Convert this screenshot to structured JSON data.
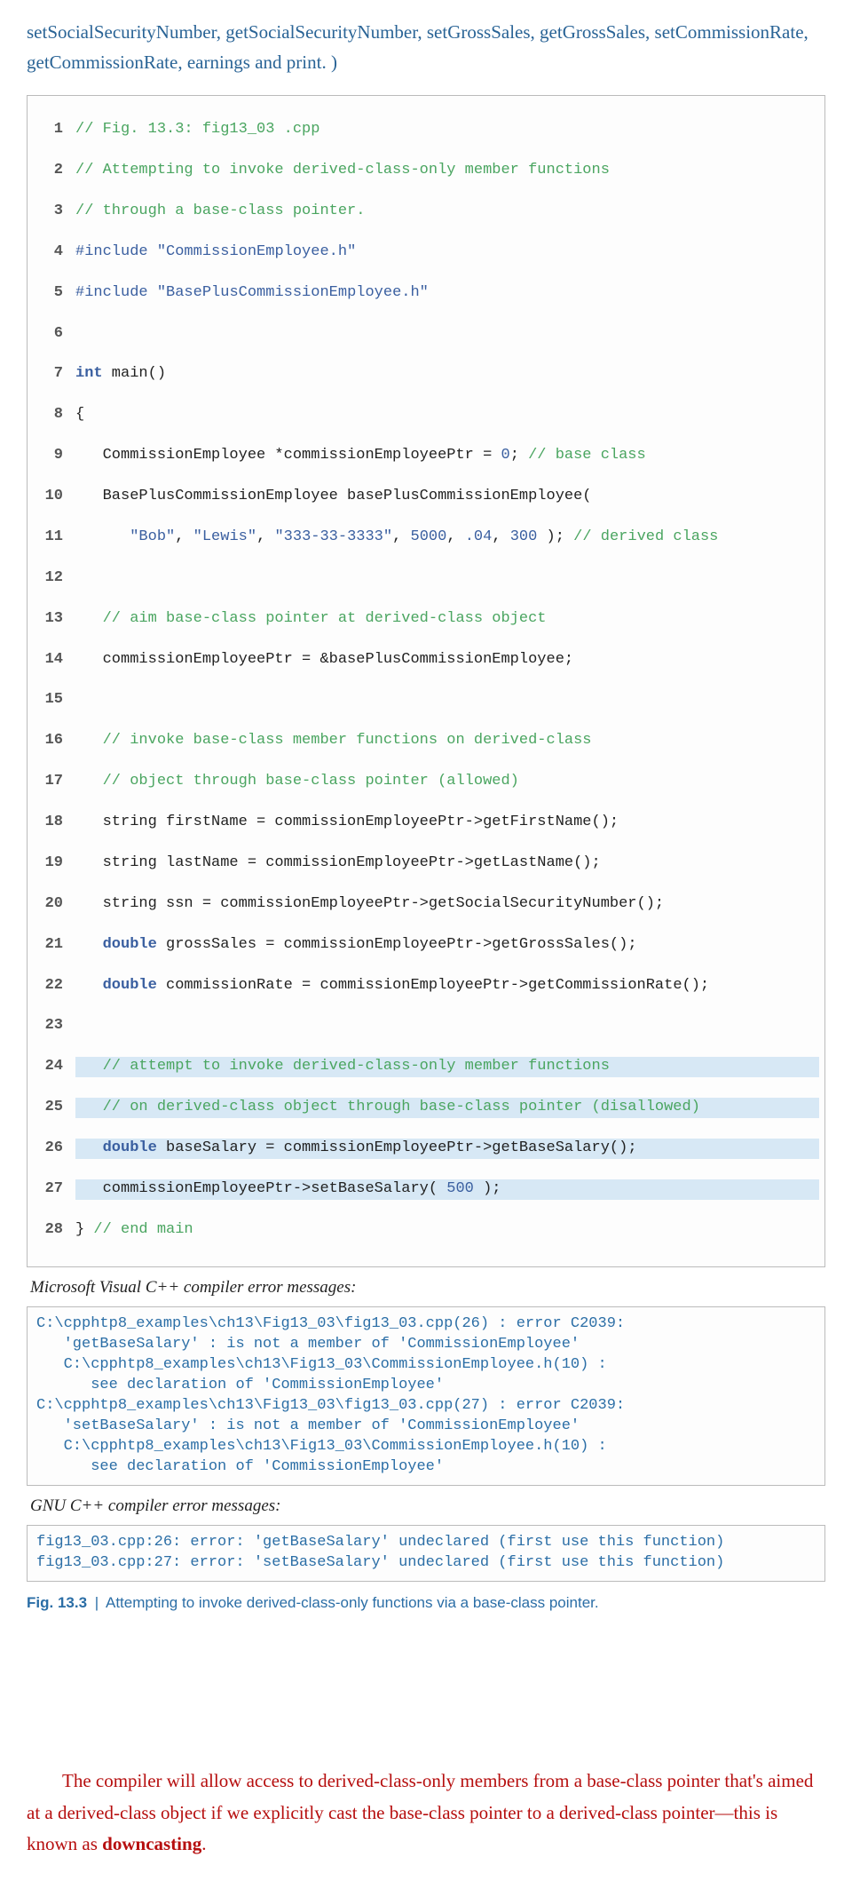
{
  "intro": "setSocialSecurityNumber, getSocialSecurityNumber, setGrossSales, getGrossSales, setCommissionRate, getCommissionRate, earnings and print. )",
  "code": {
    "l1": "// Fig. 13.3: fig13_03 .cpp",
    "l2": "// Attempting to invoke derived-class-only member functions",
    "l3": "// through a base-class pointer.",
    "l4a": "#include",
    "l4b": "\"CommissionEmployee.h\"",
    "l5a": "#include",
    "l5b": "\"BasePlusCommissionEmployee.h\"",
    "l7a": "int",
    "l7b": " main()",
    "l8": "{",
    "l9a": "   CommissionEmployee *commissionEmployeePtr = ",
    "l9n": "0",
    "l9b": "; ",
    "l9c": "// base class",
    "l10": "   BasePlusCommissionEmployee basePlusCommissionEmployee(",
    "l11a": "      ",
    "l11s1": "\"Bob\"",
    "l11p1": ", ",
    "l11s2": "\"Lewis\"",
    "l11p2": ", ",
    "l11s3": "\"333-33-3333\"",
    "l11p3": ", ",
    "l11n1": "5000",
    "l11p4": ", ",
    "l11n2": ".04",
    "l11p5": ", ",
    "l11n3": "300",
    "l11p6": " ); ",
    "l11c": "// derived class",
    "l13": "   // aim base-class pointer at derived-class object",
    "l14": "   commissionEmployeePtr = &basePlusCommissionEmployee;",
    "l16": "   // invoke base-class member functions on derived-class",
    "l17": "   // object through base-class pointer (allowed)",
    "l18": "   string firstName = commissionEmployeePtr->getFirstName();",
    "l19": "   string lastName = commissionEmployeePtr->getLastName();",
    "l20": "   string ssn = commissionEmployeePtr->getSocialSecurityNumber();",
    "l21a": "   ",
    "l21k": "double",
    "l21b": " grossSales = commissionEmployeePtr->getGrossSales();",
    "l22a": "   ",
    "l22k": "double",
    "l22b": " commissionRate = commissionEmployeePtr->getCommissionRate();",
    "l24": "   // attempt to invoke derived-class-only member functions",
    "l25": "   // on derived-class object through base-class pointer (disallowed)",
    "l26a": "   ",
    "l26k": "double",
    "l26b": " baseSalary = commissionEmployeePtr->getBaseSalary();",
    "l27a": "   commissionEmployeePtr->setBaseSalary( ",
    "l27n": "500",
    "l27b": " );",
    "l28a": "} ",
    "l28c": "// end main"
  },
  "caption1": "Microsoft Visual C++ compiler error messages:",
  "errors1": "C:\\cpphtp8_examples\\ch13\\Fig13_03\\fig13_03.cpp(26) : error C2039:\n   'getBaseSalary' : is not a member of 'CommissionEmployee'\n   C:\\cpphtp8_examples\\ch13\\Fig13_03\\CommissionEmployee.h(10) :\n      see declaration of 'CommissionEmployee'\nC:\\cpphtp8_examples\\ch13\\Fig13_03\\fig13_03.cpp(27) : error C2039:\n   'setBaseSalary' : is not a member of 'CommissionEmployee'\n   C:\\cpphtp8_examples\\ch13\\Fig13_03\\CommissionEmployee.h(10) :\n      see declaration of 'CommissionEmployee'",
  "caption2": "GNU C++ compiler error messages:",
  "errors2": "fig13_03.cpp:26: error: 'getBaseSalary' undeclared (first use this function)\nfig13_03.cpp:27: error: 'setBaseSalary' undeclared (first use this function)",
  "fig_num": "Fig. 13.3",
  "fig_text": "Attempting to invoke derived-class-only functions via a base-class pointer.",
  "para_red1": "The compiler will allow access to derived-class-only members from a base-class pointer that's aimed at a derived-class object if we explicitly cast the base-class pointer to a derived-class pointer—this is known as ",
  "para_bold": "downcasting",
  "para_end": "."
}
